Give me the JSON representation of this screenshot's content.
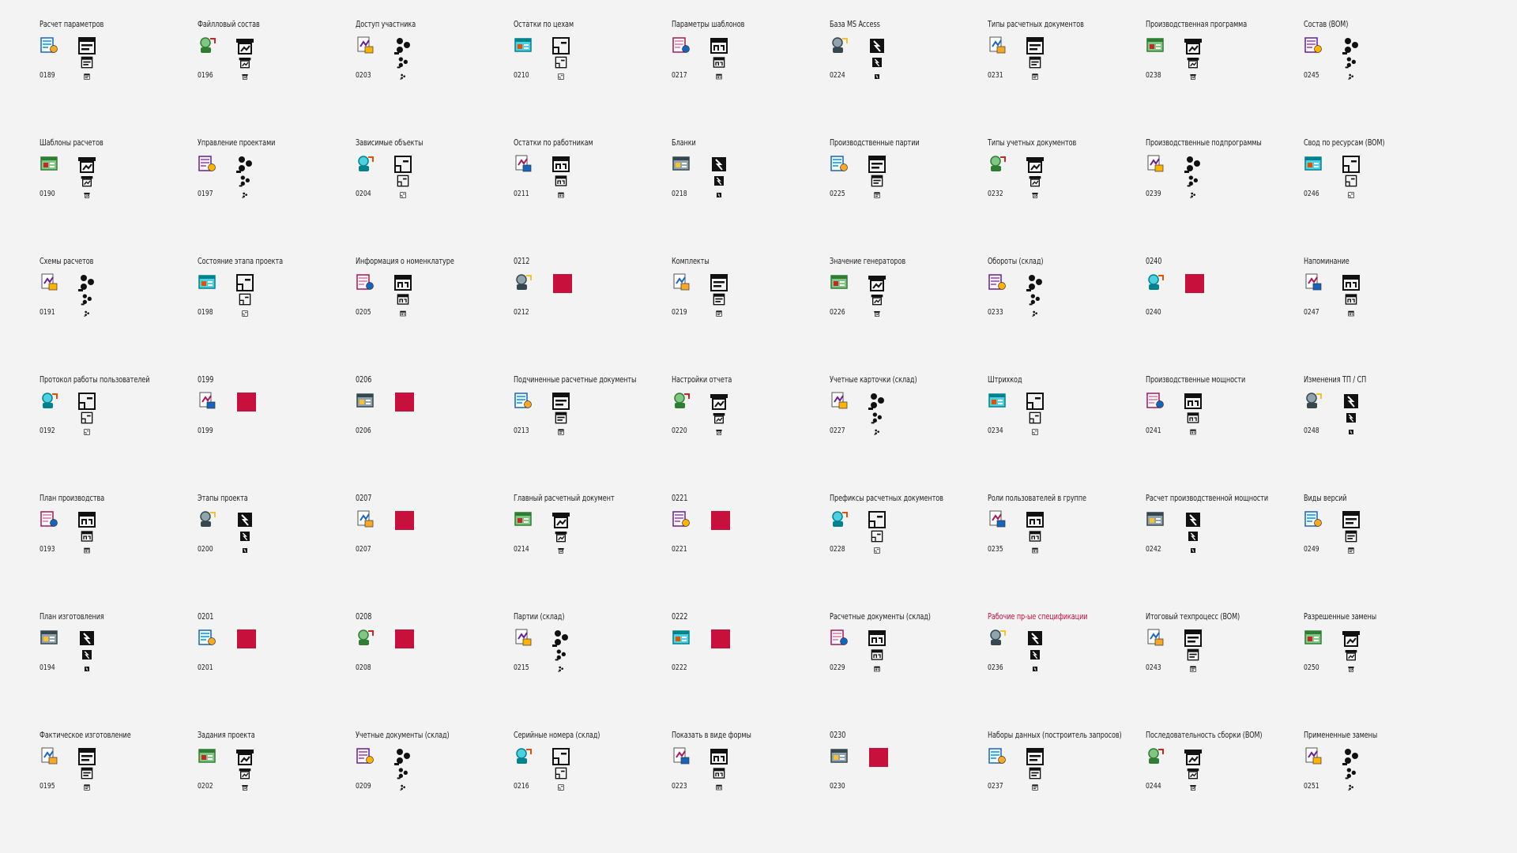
{
  "accent_color": "#c8103c",
  "placeholder_color": "#c8103c",
  "items": [
    {
      "title": "Расчет параметров",
      "code": "0189",
      "icon": "calc-params-icon",
      "placeholder": false,
      "highlight": false
    },
    {
      "title": "Шаблоны расчетов",
      "code": "0190",
      "icon": "calc-templates-icon",
      "placeholder": false,
      "highlight": false
    },
    {
      "title": "Схемы расчетов",
      "code": "0191",
      "icon": "calc-schemes-icon",
      "placeholder": false,
      "highlight": false
    },
    {
      "title": "Протокол работы пользователей",
      "code": "0192",
      "icon": "user-log-icon",
      "placeholder": false,
      "highlight": false
    },
    {
      "title": "План производства",
      "code": "0193",
      "icon": "production-plan-icon",
      "placeholder": false,
      "highlight": false
    },
    {
      "title": "План изготовления",
      "code": "0194",
      "icon": "manufacturing-plan-icon",
      "placeholder": false,
      "highlight": false
    },
    {
      "title": "Фактическое изготовление",
      "code": "0195",
      "icon": "actual-manufacturing-icon",
      "placeholder": false,
      "highlight": false
    },
    {
      "title": "Файлловый состав",
      "code": "0196",
      "icon": "file-composition-icon",
      "placeholder": false,
      "highlight": false
    },
    {
      "title": "Управление проектами",
      "code": "0197",
      "icon": "project-management-icon",
      "placeholder": false,
      "highlight": false
    },
    {
      "title": "Состояние этапа проекта",
      "code": "0198",
      "icon": "project-stage-state-icon",
      "placeholder": false,
      "highlight": false
    },
    {
      "title": "0199",
      "code": "0199",
      "icon": "generic-0199-icon",
      "placeholder": true,
      "highlight": false
    },
    {
      "title": "Этапы проекта",
      "code": "0200",
      "icon": "project-stages-icon",
      "placeholder": false,
      "highlight": false
    },
    {
      "title": "0201",
      "code": "0201",
      "icon": "generic-0201-icon",
      "placeholder": true,
      "highlight": false
    },
    {
      "title": "Задания проекта",
      "code": "0202",
      "icon": "project-tasks-icon",
      "placeholder": false,
      "highlight": false
    },
    {
      "title": "Доступ участника",
      "code": "0203",
      "icon": "member-access-icon",
      "placeholder": false,
      "highlight": false
    },
    {
      "title": "Зависимые объекты",
      "code": "0204",
      "icon": "dependent-objects-icon",
      "placeholder": false,
      "highlight": false
    },
    {
      "title": "Информация о номенклатуре",
      "code": "0205",
      "icon": "nomenclature-info-icon",
      "placeholder": false,
      "highlight": false
    },
    {
      "title": "0206",
      "code": "0206",
      "icon": "generic-0206-icon",
      "placeholder": true,
      "highlight": false
    },
    {
      "title": "0207",
      "code": "0207",
      "icon": "generic-0207-icon",
      "placeholder": true,
      "highlight": false
    },
    {
      "title": "0208",
      "code": "0208",
      "icon": "generic-0208-icon",
      "placeholder": true,
      "highlight": false
    },
    {
      "title": "Учетные документы (склад)",
      "code": "0209",
      "icon": "warehouse-docs-icon",
      "placeholder": false,
      "highlight": false
    },
    {
      "title": "Остатки по цехам",
      "code": "0210",
      "icon": "workshop-balances-icon",
      "placeholder": false,
      "highlight": false
    },
    {
      "title": "Остатки по работникам",
      "code": "0211",
      "icon": "worker-balances-icon",
      "placeholder": false,
      "highlight": false
    },
    {
      "title": "0212",
      "code": "0212",
      "icon": "generic-0212-icon",
      "placeholder": true,
      "highlight": false
    },
    {
      "title": "Подчиненные расчетные документы",
      "code": "0213",
      "icon": "subordinate-docs-icon",
      "placeholder": false,
      "highlight": false
    },
    {
      "title": "Главный расчетный документ",
      "code": "0214",
      "icon": "main-calc-doc-icon",
      "placeholder": false,
      "highlight": false
    },
    {
      "title": "Партии (склад)",
      "code": "0215",
      "icon": "batches-icon",
      "placeholder": false,
      "highlight": false
    },
    {
      "title": "Серийные номера (склад)",
      "code": "0216",
      "icon": "serial-numbers-icon",
      "placeholder": false,
      "highlight": false
    },
    {
      "title": "Параметры шаблонов",
      "code": "0217",
      "icon": "template-params-icon",
      "placeholder": false,
      "highlight": false
    },
    {
      "title": "Бланки",
      "code": "0218",
      "icon": "blanks-icon",
      "placeholder": false,
      "highlight": false
    },
    {
      "title": "Комплекты",
      "code": "0219",
      "icon": "kits-icon",
      "placeholder": false,
      "highlight": false
    },
    {
      "title": "Настройки отчета",
      "code": "0220",
      "icon": "report-settings-icon",
      "placeholder": false,
      "highlight": false
    },
    {
      "title": "0221",
      "code": "0221",
      "icon": "generic-0221-icon",
      "placeholder": true,
      "highlight": false
    },
    {
      "title": "0222",
      "code": "0222",
      "icon": "generic-0222-icon",
      "placeholder": true,
      "highlight": false
    },
    {
      "title": "Показать в виде формы",
      "code": "0223",
      "icon": "show-as-form-icon",
      "placeholder": false,
      "highlight": false
    },
    {
      "title": "База MS Access",
      "code": "0224",
      "icon": "ms-access-db-icon",
      "placeholder": false,
      "highlight": false
    },
    {
      "title": "Производственные партии",
      "code": "0225",
      "icon": "production-batches-icon",
      "placeholder": false,
      "highlight": false
    },
    {
      "title": "Значение генераторов",
      "code": "0226",
      "icon": "generator-values-icon",
      "placeholder": false,
      "highlight": false
    },
    {
      "title": "Учетные карточки (склад)",
      "code": "0227",
      "icon": "warehouse-cards-icon",
      "placeholder": false,
      "highlight": false
    },
    {
      "title": "Префиксы расчетных документов",
      "code": "0228",
      "icon": "doc-prefixes-icon",
      "placeholder": false,
      "highlight": false
    },
    {
      "title": "Расчетные документы (склад)",
      "code": "0229",
      "icon": "warehouse-calc-docs-icon",
      "placeholder": false,
      "highlight": false
    },
    {
      "title": "0230",
      "code": "0230",
      "icon": "generic-0230-icon",
      "placeholder": true,
      "highlight": false
    },
    {
      "title": "Типы расчетных документов",
      "code": "0231",
      "icon": "calc-doc-types-icon",
      "placeholder": false,
      "highlight": false
    },
    {
      "title": "Типы учетных документов",
      "code": "0232",
      "icon": "account-doc-types-icon",
      "placeholder": false,
      "highlight": false
    },
    {
      "title": "Обороты (склад)",
      "code": "0233",
      "icon": "turnover-icon",
      "placeholder": false,
      "highlight": false
    },
    {
      "title": "Штрихкод",
      "code": "0234",
      "icon": "barcode-icon",
      "placeholder": false,
      "highlight": false
    },
    {
      "title": "Роли пользователей в группе",
      "code": "0235",
      "icon": "user-roles-icon",
      "placeholder": false,
      "highlight": false
    },
    {
      "title": "Рабочие пр-ые спецификации",
      "code": "0236",
      "icon": "work-specs-icon",
      "placeholder": false,
      "highlight": true
    },
    {
      "title": "Наборы данных (построитель запросов)",
      "code": "0237",
      "icon": "sql-datasets-icon",
      "placeholder": false,
      "highlight": false
    },
    {
      "title": "Производственная программа",
      "code": "0238",
      "icon": "production-program-icon",
      "placeholder": false,
      "highlight": false
    },
    {
      "title": "Производственные подпрограммы",
      "code": "0239",
      "icon": "production-subprograms-icon",
      "placeholder": false,
      "highlight": false
    },
    {
      "title": "0240",
      "code": "0240",
      "icon": "generic-0240-icon",
      "placeholder": true,
      "highlight": false
    },
    {
      "title": "Производственные мощности",
      "code": "0241",
      "icon": "production-capacity-icon",
      "placeholder": false,
      "highlight": false
    },
    {
      "title": "Расчет производственной мощности",
      "code": "0242",
      "icon": "capacity-calc-icon",
      "placeholder": false,
      "highlight": false
    },
    {
      "title": "Итоговый техпроцесс (BOM)",
      "code": "0243",
      "icon": "final-process-icon",
      "placeholder": false,
      "highlight": false
    },
    {
      "title": "Последовательность сборки (BOM)",
      "code": "0244",
      "icon": "assembly-sequence-icon",
      "placeholder": false,
      "highlight": false
    },
    {
      "title": "Состав (BOM)",
      "code": "0245",
      "icon": "bom-composition-icon",
      "placeholder": false,
      "highlight": false
    },
    {
      "title": "Свод по ресурсам (BOM)",
      "code": "0246",
      "icon": "resource-summary-icon",
      "placeholder": false,
      "highlight": false
    },
    {
      "title": "Напоминание",
      "code": "0247",
      "icon": "reminder-bell-icon",
      "placeholder": false,
      "highlight": false
    },
    {
      "title": "Изменения ТП / СП",
      "code": "0248",
      "icon": "changes-icon",
      "placeholder": false,
      "highlight": false
    },
    {
      "title": "Виды версий",
      "code": "0249",
      "icon": "version-types-icon",
      "placeholder": false,
      "highlight": false
    },
    {
      "title": "Разрешенные замены",
      "code": "0250",
      "icon": "allowed-replacements-icon",
      "placeholder": false,
      "highlight": false
    },
    {
      "title": "Примененные замены",
      "code": "0251",
      "icon": "applied-replacements-icon",
      "placeholder": false,
      "highlight": false
    }
  ]
}
